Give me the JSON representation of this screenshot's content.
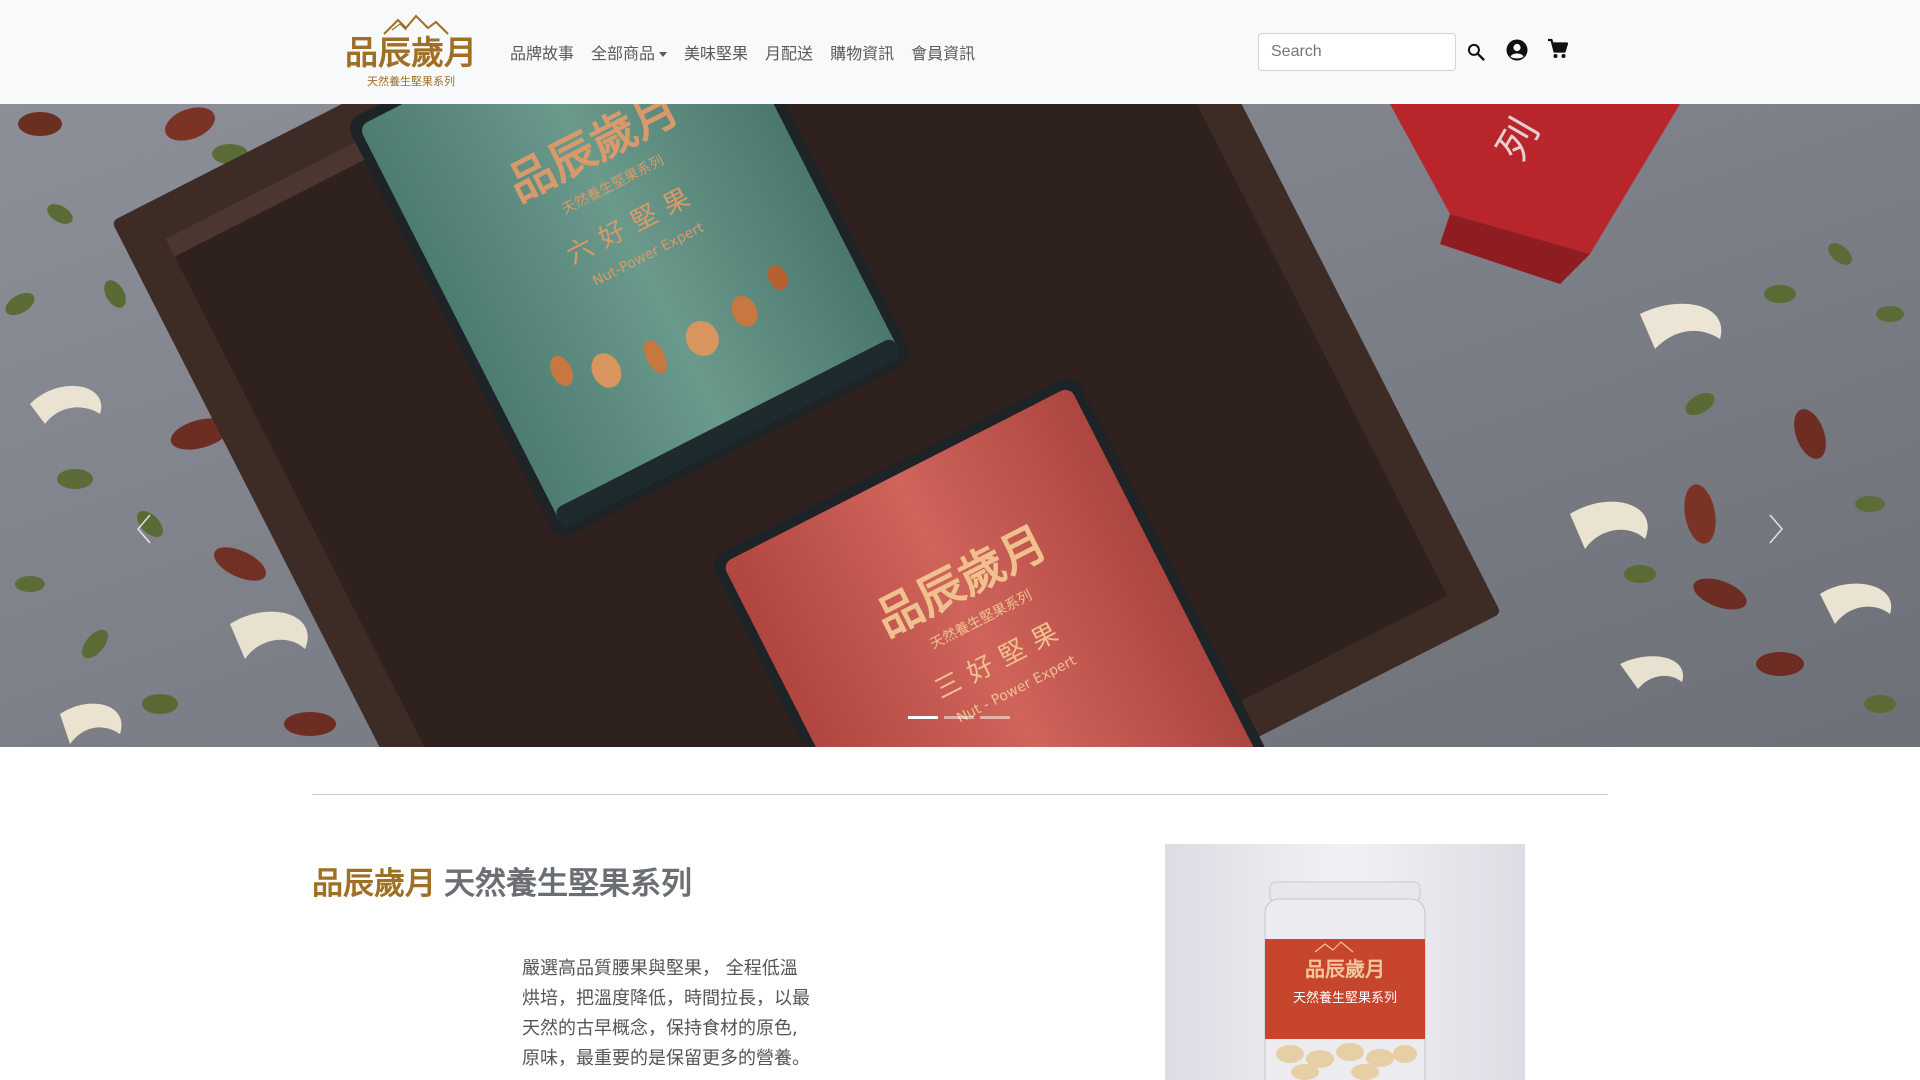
{
  "navbar": {
    "brand": {
      "logo_text": "品辰歲月",
      "logo_subtitle": "天然養生堅果系列"
    },
    "links": [
      {
        "label": "品牌故事"
      },
      {
        "label": "全部商品",
        "dropdown": true
      },
      {
        "label": "美味堅果"
      },
      {
        "label": "月配送"
      },
      {
        "label": "購物資訊"
      },
      {
        "label": "會員資訊"
      }
    ],
    "search": {
      "placeholder": "Search",
      "value": ""
    },
    "icons": [
      "search-icon",
      "user-circle-icon",
      "shopping-cart-icon"
    ]
  },
  "carousel": {
    "slide_count": 3,
    "active_index": 0,
    "controls": [
      "chevron-left-icon",
      "chevron-right-icon"
    ],
    "slide": {
      "green_can": {
        "logo": "品辰歲月",
        "subtitle": "天然養生堅果系列",
        "product": "六好堅果",
        "english": "Nut-Power Expert"
      },
      "red_can": {
        "logo": "品辰歲月",
        "subtitle": "天然養生堅果系列",
        "product": "三好堅果",
        "english": "Nut - Power Expert"
      },
      "box_fragment": "列"
    }
  },
  "content": {
    "heading_brand": "品辰歲月",
    "heading_series": "天然養生堅果系列",
    "description_lines": [
      "嚴選高品質腰果與堅果， 全程低溫",
      "烘培，把溫度降低，時間拉長，以最",
      "天然的古早概念，保持食材的原色,",
      "原味，最重要的是保留更多的營養。"
    ],
    "product_jar": {
      "logo": "品辰歲月",
      "label": "天然養生堅果系列"
    }
  },
  "colors": {
    "navbar_bg": "#f8f9fa",
    "brand_gold": "#a06f26",
    "heading_gray": "#6b6f74",
    "can_green": "#5f8e80",
    "can_red": "#c9574f",
    "box_brown": "#3b2a25"
  }
}
